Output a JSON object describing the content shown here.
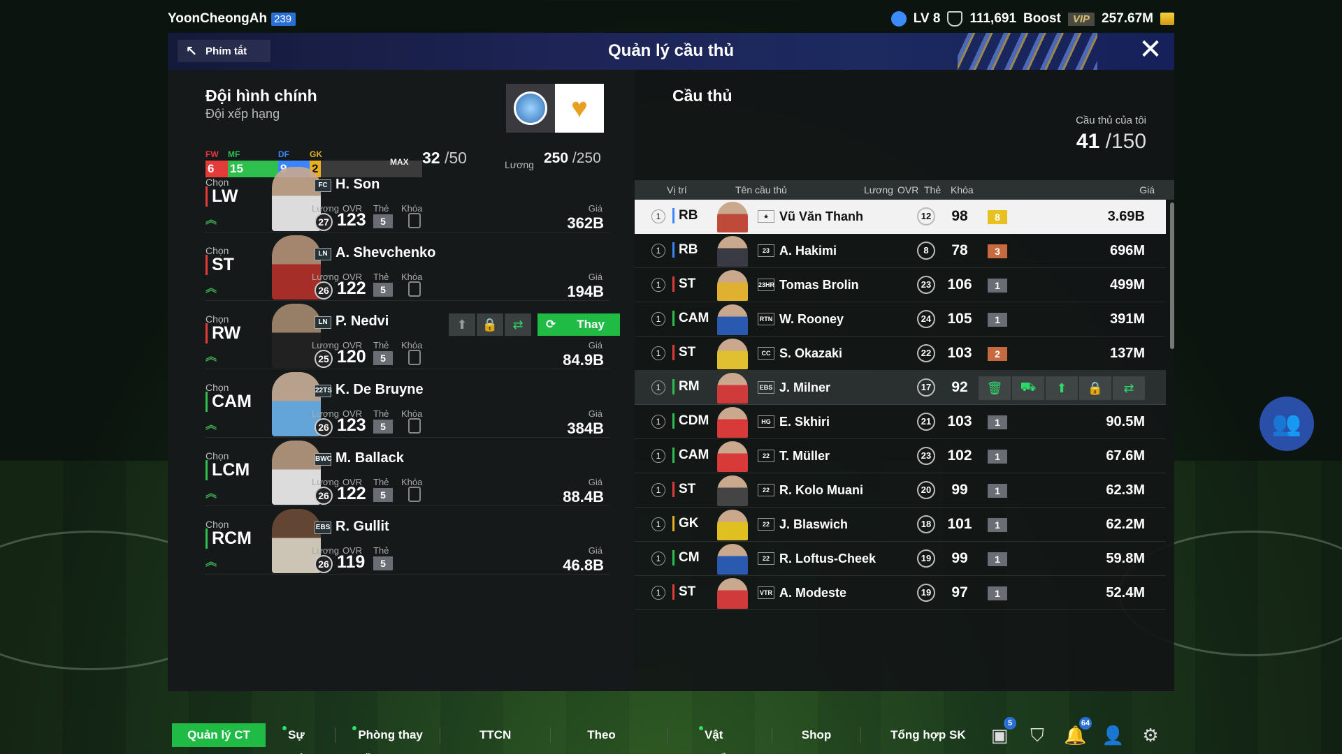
{
  "user": {
    "name": "YoonCheongAh",
    "badge": "239"
  },
  "stats": {
    "level": "LV 8",
    "points": "111,691",
    "boost": "Boost",
    "vip": "VIP",
    "money": "257.67M"
  },
  "header": {
    "shortcut": "Phím tắt",
    "title": "Quản lý cầu thủ"
  },
  "squad": {
    "title": "Đội hình chính",
    "subtitle": "Đội xếp hạng",
    "fw_label": "FW",
    "mf_label": "MF",
    "df_label": "DF",
    "gk_label": "GK",
    "fw": 6,
    "mf": 15,
    "df": 9,
    "gk": 2,
    "max_label": "MAX",
    "count": "32",
    "count_max": "/50",
    "wage_label": "Lương",
    "wage": "250",
    "wage_max": "/250"
  },
  "labels": {
    "choose": "Chọn",
    "wage": "Lương",
    "ovr": "OVR",
    "card": "Thẻ",
    "lock": "Khóa",
    "price": "Giá",
    "replace": "Thay"
  },
  "lineup": [
    {
      "pos": "LW",
      "pos_color": "#e33a3a",
      "season": "FC",
      "name": "H. Son",
      "wage": "27",
      "ovr": "123",
      "card": "5",
      "price": "362B"
    },
    {
      "pos": "ST",
      "pos_color": "#e33a3a",
      "season": "LN",
      "name": "A. Shevchenko",
      "wage": "26",
      "ovr": "122",
      "card": "5",
      "price": "194B"
    },
    {
      "pos": "RW",
      "pos_color": "#e33a3a",
      "season": "LN",
      "name": "P. Nedvi",
      "wage": "25",
      "ovr": "120",
      "card": "5",
      "price": "84.9B"
    },
    {
      "pos": "CAM",
      "pos_color": "#2fbf4e",
      "season": "22TS",
      "name": "K. De Bruyne",
      "wage": "26",
      "ovr": "123",
      "card": "5",
      "price": "384B"
    },
    {
      "pos": "LCM",
      "pos_color": "#2fbf4e",
      "season": "BWC",
      "name": "M. Ballack",
      "wage": "26",
      "ovr": "122",
      "card": "5",
      "price": "88.4B"
    },
    {
      "pos": "RCM",
      "pos_color": "#2fbf4e",
      "season": "EBS",
      "name": "R. Gullit",
      "wage": "26",
      "ovr": "119",
      "card": "5",
      "price": "46.8B"
    }
  ],
  "players_panel": {
    "title": "Cầu thủ",
    "mine_label": "Cầu thủ của tôi",
    "mine_count": "41",
    "mine_max": "/150",
    "columns": {
      "pos": "Vị trí",
      "name": "Tên cầu thủ",
      "wage": "Lương",
      "ovr": "OVR",
      "card": "Thẻ",
      "lock": "Khóa",
      "price": "Giá"
    }
  },
  "players": [
    {
      "num": "1",
      "pos": "RB",
      "pos_color": "#3b86ff",
      "season": "★",
      "name": "Vũ Văn Thanh",
      "wage": "12",
      "ovr": "98",
      "card": "8",
      "card_color": "#e8c020",
      "price": "3.69B"
    },
    {
      "num": "1",
      "pos": "RB",
      "pos_color": "#3b86ff",
      "season": "23",
      "name": "A. Hakimi",
      "wage": "8",
      "ovr": "78",
      "card": "3",
      "card_color": "#c86a40",
      "price": "696M"
    },
    {
      "num": "1",
      "pos": "ST",
      "pos_color": "#e33a3a",
      "season": "23HR",
      "name": "Tomas Brolin",
      "wage": "23",
      "ovr": "106",
      "card": "1",
      "card_color": "#6a6e74",
      "price": "499M"
    },
    {
      "num": "1",
      "pos": "CAM",
      "pos_color": "#2fbf4e",
      "season": "RTN",
      "name": "W. Rooney",
      "wage": "24",
      "ovr": "105",
      "card": "1",
      "card_color": "#6a6e74",
      "price": "391M"
    },
    {
      "num": "1",
      "pos": "ST",
      "pos_color": "#e33a3a",
      "season": "CC",
      "name": "S. Okazaki",
      "wage": "22",
      "ovr": "103",
      "card": "2",
      "card_color": "#c86a40",
      "price": "137M"
    },
    {
      "num": "1",
      "pos": "RM",
      "pos_color": "#2fbf4e",
      "season": "EBS",
      "name": "J. Milner",
      "wage": "17",
      "ovr": "92",
      "card": "",
      "card_color": "",
      "price": ""
    },
    {
      "num": "1",
      "pos": "CDM",
      "pos_color": "#2fbf4e",
      "season": "HG",
      "name": "E. Skhiri",
      "wage": "21",
      "ovr": "103",
      "card": "1",
      "card_color": "#6a6e74",
      "price": "90.5M"
    },
    {
      "num": "1",
      "pos": "CAM",
      "pos_color": "#2fbf4e",
      "season": "22",
      "name": "T. Müller",
      "wage": "23",
      "ovr": "102",
      "card": "1",
      "card_color": "#6a6e74",
      "price": "67.6M"
    },
    {
      "num": "1",
      "pos": "ST",
      "pos_color": "#e33a3a",
      "season": "22",
      "name": "R. Kolo Muani",
      "wage": "20",
      "ovr": "99",
      "card": "1",
      "card_color": "#6a6e74",
      "price": "62.3M"
    },
    {
      "num": "1",
      "pos": "GK",
      "pos_color": "#e8b020",
      "season": "22",
      "name": "J. Blaswich",
      "wage": "18",
      "ovr": "101",
      "card": "1",
      "card_color": "#6a6e74",
      "price": "62.2M"
    },
    {
      "num": "1",
      "pos": "CM",
      "pos_color": "#2fbf4e",
      "season": "22",
      "name": "R. Loftus-Cheek",
      "wage": "19",
      "ovr": "99",
      "card": "1",
      "card_color": "#6a6e74",
      "price": "59.8M"
    },
    {
      "num": "1",
      "pos": "ST",
      "pos_color": "#e33a3a",
      "season": "VTR",
      "name": "A. Modeste",
      "wage": "19",
      "ovr": "97",
      "card": "1",
      "card_color": "#6a6e74",
      "price": "52.4M"
    }
  ],
  "nav": {
    "items": [
      "Quản lý CT",
      "Sự kiện",
      "Phòng thay đồ",
      "TTCN",
      "Theo dõi",
      "Vật phẩm",
      "Shop",
      "Tổng hợp SK mới"
    ],
    "badge_events": "5",
    "badge_notif": "64"
  }
}
